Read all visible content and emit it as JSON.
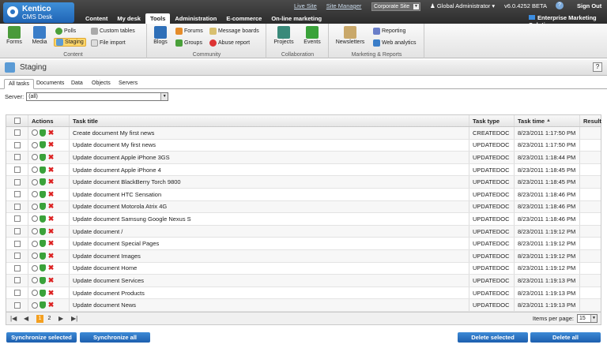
{
  "logo": {
    "name": "Kentico",
    "product": "CMS Desk"
  },
  "main_tabs": [
    {
      "label": "Content"
    },
    {
      "label": "My desk"
    },
    {
      "label": "Tools"
    },
    {
      "label": "Administration"
    },
    {
      "label": "E-commerce"
    },
    {
      "label": "On-line marketing"
    }
  ],
  "active_main_tab": "Tools",
  "top_links": {
    "live_site": "Live Site",
    "site_manager": "Site Manager"
  },
  "site_select": "Corporate Site",
  "user": "Global Administrator",
  "version": "v6.0.4252 BETA",
  "sign_out": "Sign Out",
  "solution_label": "Enterprise Marketing Solution",
  "ribbon": {
    "content": {
      "name": "Content",
      "forms": "Forms",
      "media": "Media",
      "polls": "Polls",
      "staging": "Staging",
      "custom_tables": "Custom tables",
      "file_import": "File import"
    },
    "community": {
      "name": "Community",
      "blogs": "Blogs",
      "forums": "Forums",
      "groups": "Groups",
      "message_boards": "Message boards",
      "abuse_report": "Abuse report"
    },
    "collaboration": {
      "name": "Collaboration",
      "projects": "Projects",
      "events": "Events"
    },
    "marketing": {
      "name": "Marketing & Reports",
      "newsletters": "Newsletters",
      "reporting": "Reporting",
      "web_analytics": "Web analytics"
    }
  },
  "page_title": "Staging",
  "help": "?",
  "sub_tabs": [
    {
      "label": "All tasks"
    },
    {
      "label": "Documents"
    },
    {
      "label": "Data"
    },
    {
      "label": "Objects"
    },
    {
      "label": "Servers"
    }
  ],
  "server_filter": {
    "label": "Server:",
    "value": "(all)"
  },
  "grid": {
    "headers": {
      "actions": "Actions",
      "title": "Task title",
      "type": "Task type",
      "time": "Task time",
      "result": "Result"
    },
    "sort_indicator": "▲",
    "rows": [
      {
        "title": "Create document My first news",
        "type": "CREATEDOC",
        "time": "8/23/2011 1:17:50 PM"
      },
      {
        "title": "Update document My first news",
        "type": "UPDATEDOC",
        "time": "8/23/2011 1:17:50 PM"
      },
      {
        "title": "Update document Apple iPhone 3GS",
        "type": "UPDATEDOC",
        "time": "8/23/2011 1:18:44 PM"
      },
      {
        "title": "Update document Apple iPhone 4",
        "type": "UPDATEDOC",
        "time": "8/23/2011 1:18:45 PM"
      },
      {
        "title": "Update document BlackBerry Torch 9800",
        "type": "UPDATEDOC",
        "time": "8/23/2011 1:18:45 PM"
      },
      {
        "title": "Update document HTC Sensation",
        "type": "UPDATEDOC",
        "time": "8/23/2011 1:18:46 PM"
      },
      {
        "title": "Update document Motorola Atrix 4G",
        "type": "UPDATEDOC",
        "time": "8/23/2011 1:18:46 PM"
      },
      {
        "title": "Update document Samsung Google Nexus S",
        "type": "UPDATEDOC",
        "time": "8/23/2011 1:18:46 PM"
      },
      {
        "title": "Update document /",
        "type": "UPDATEDOC",
        "time": "8/23/2011 1:19:12 PM"
      },
      {
        "title": "Update document Special Pages",
        "type": "UPDATEDOC",
        "time": "8/23/2011 1:19:12 PM"
      },
      {
        "title": "Update document Images",
        "type": "UPDATEDOC",
        "time": "8/23/2011 1:19:12 PM"
      },
      {
        "title": "Update document Home",
        "type": "UPDATEDOC",
        "time": "8/23/2011 1:19:12 PM"
      },
      {
        "title": "Update document Services",
        "type": "UPDATEDOC",
        "time": "8/23/2011 1:19:13 PM"
      },
      {
        "title": "Update document Products",
        "type": "UPDATEDOC",
        "time": "8/23/2011 1:19:13 PM"
      },
      {
        "title": "Update document News",
        "type": "UPDATEDOC",
        "time": "8/23/2011 1:19:13 PM"
      }
    ]
  },
  "pager": {
    "pages": [
      "1",
      "2"
    ],
    "current": "1",
    "items_per_page_label": "Items per page:",
    "items_per_page": "15"
  },
  "buttons": {
    "sync_selected": "Synchronize selected",
    "sync_all": "Synchronize all",
    "delete_selected": "Delete selected",
    "delete_all": "Delete all"
  }
}
